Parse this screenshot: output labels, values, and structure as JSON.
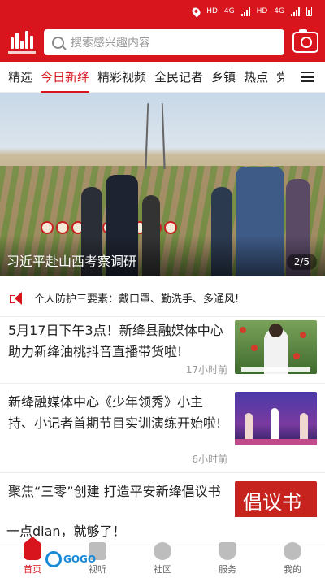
{
  "status_bar": {
    "net1": "HD",
    "net2": "4G",
    "net3": "HD",
    "net4": "4G"
  },
  "header": {
    "search_placeholder": "搜索感兴趣内容"
  },
  "tabs": [
    {
      "label": "精选"
    },
    {
      "label": "今日新绛",
      "active": true
    },
    {
      "label": "精彩视频"
    },
    {
      "label": "全民记者"
    },
    {
      "label": "乡镇"
    },
    {
      "label": "热点"
    },
    {
      "label": "党"
    }
  ],
  "banner": {
    "caption": "习近平赴山西考察调研",
    "pager": "2/5"
  },
  "notice": {
    "text": "个人防护三要素：戴口罩、勤洗手、多通风!"
  },
  "news": [
    {
      "title": "5月17日下午3点！新绛县融媒体中心助力新绛油桃抖音直播带货啦!",
      "time": "17小时前"
    },
    {
      "title": "新绛融媒体中心《少年领秀》小主持、小记者首期节目实训演练开始啦!",
      "time": "6小时前"
    },
    {
      "title": "聚焦“三零”创建 打造平安新绛倡议书",
      "thumb_text": "倡议书"
    }
  ],
  "overlay_text": "一点dian，就够了！",
  "watermark": "GOGO",
  "bottom_nav": [
    {
      "label": "首页",
      "active": true
    },
    {
      "label": "视听"
    },
    {
      "label": "社区"
    },
    {
      "label": "服务"
    },
    {
      "label": "我的"
    }
  ],
  "colors": {
    "brand_red": "#d8141c"
  }
}
